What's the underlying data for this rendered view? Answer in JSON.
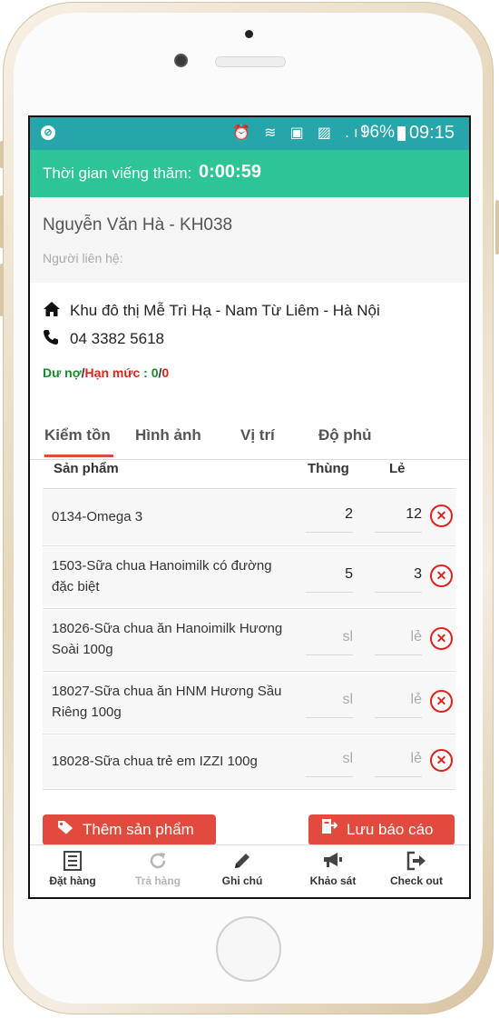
{
  "status_bar": {
    "battery": "96%",
    "time": "09:15"
  },
  "visit": {
    "label": "Thời gian viếng thăm:",
    "timer": "0:00:59"
  },
  "customer": {
    "name": "Nguyễn Văn Hà - KH038",
    "contact_label": "Người liên hệ:",
    "address": "Khu đô thị Mễ Trì Hạ - Nam Từ Liêm - Hà Nội",
    "phone": "04 3382 5618",
    "debt_label": "Dư nợ",
    "limit_label": "Hạn mức",
    "separator": " : ",
    "debt_value": "0",
    "limit_value": "0"
  },
  "tabs": [
    {
      "label": "Kiểm tồn",
      "active": true
    },
    {
      "label": "Hình ảnh",
      "active": false
    },
    {
      "label": "Vị trí",
      "active": false
    },
    {
      "label": "Độ phủ",
      "active": false
    }
  ],
  "table": {
    "headers": {
      "product": "Sản phẩm",
      "case": "Thùng",
      "unit": "Lẻ"
    },
    "rows": [
      {
        "name": "0134-Omega 3",
        "case": "2",
        "unit": "12",
        "case_ph": "",
        "unit_ph": ""
      },
      {
        "name": "1503-Sữa chua Hanoimilk có đường đặc biệt",
        "case": "5",
        "unit": "3",
        "case_ph": "",
        "unit_ph": ""
      },
      {
        "name": "18026-Sữa chua ăn Hanoimilk Hương Soài 100g",
        "case": "",
        "unit": "",
        "case_ph": "sl",
        "unit_ph": "lẻ"
      },
      {
        "name": "18027-Sữa chua ăn HNM Hương Sầu Riêng 100g",
        "case": "",
        "unit": "",
        "case_ph": "sl",
        "unit_ph": "lẻ"
      },
      {
        "name": "18028-Sữa chua trẻ em IZZI 100g",
        "case": "",
        "unit": "",
        "case_ph": "sl",
        "unit_ph": "lẻ"
      }
    ]
  },
  "actions": {
    "add_product": "Thêm sản phẩm",
    "save_report": "Lưu báo cáo"
  },
  "bottom_nav": [
    {
      "label": "Đặt hàng",
      "icon": "list-icon",
      "disabled": false
    },
    {
      "label": "Trả hàng",
      "icon": "refresh-icon",
      "disabled": true
    },
    {
      "label": "Ghi chú",
      "icon": "pencil-icon",
      "disabled": false
    },
    {
      "label": "Khảo sát",
      "icon": "megaphone-icon",
      "disabled": false
    },
    {
      "label": "Check out",
      "icon": "sign-out-icon",
      "disabled": false
    }
  ],
  "colors": {
    "status_bar": "#26a5aa",
    "visit_bar": "#2ec596",
    "accent": "#e04b3d",
    "debt_green": "#1a8a2a",
    "limit_red": "#d9261c"
  }
}
